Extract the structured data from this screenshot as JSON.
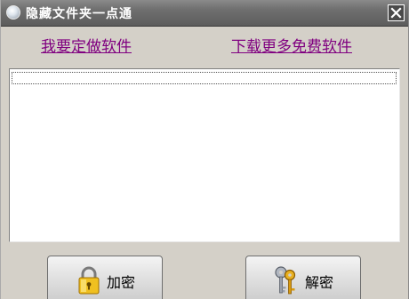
{
  "window": {
    "title": "隐藏文件夹一点通"
  },
  "links": {
    "custom_software": "我要定做软件",
    "download_more": "下载更多免费软件"
  },
  "folder_list": {
    "items": [
      ""
    ]
  },
  "buttons": {
    "encrypt_label": "加密",
    "decrypt_label": "解密"
  },
  "icons": {
    "app": "app-globe-icon",
    "close": "close-icon",
    "encrypt": "padlock-icon",
    "decrypt": "keys-icon"
  },
  "colors": {
    "titlebar": "#6a6a6a",
    "link": "#800080",
    "window_bg": "#d4d0c8"
  }
}
